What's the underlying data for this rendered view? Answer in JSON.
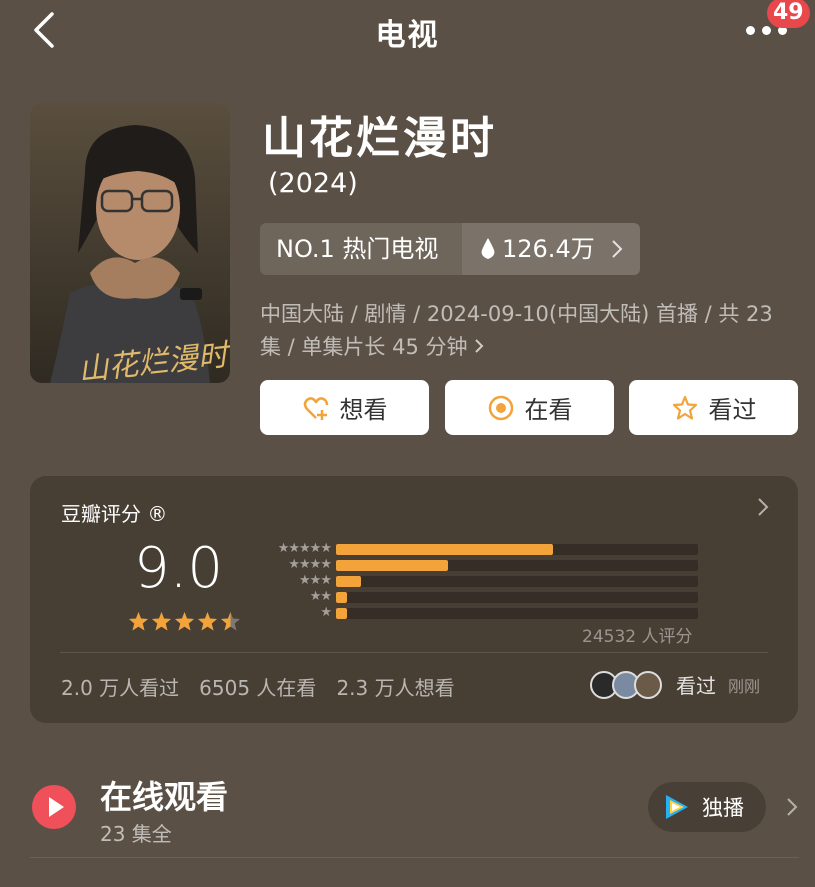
{
  "nav": {
    "title": "电视",
    "badge": "49"
  },
  "poster": {
    "text": "山花烂漫时"
  },
  "title": "山花烂漫时",
  "year": "(2024)",
  "rank": {
    "label": "NO.1 热门电视",
    "heat": "126.4万"
  },
  "meta": "中国大陆 / 剧情 / 2024-09-10(中国大陆) 首播 / 共 23 集 / 单集片长 45 分钟",
  "actions": {
    "want": "想看",
    "watching": "在看",
    "watched": "看过"
  },
  "rating": {
    "title": "豆瓣评分 ®",
    "score": "9.0",
    "stars": 4.5,
    "distribution_stars": [
      "★★★★★",
      "★★★★",
      "★★★",
      "★★",
      "★"
    ],
    "distribution": [
      0.6,
      0.31,
      0.07,
      0.03,
      0.03
    ],
    "count": "24532 人评分",
    "stats": {
      "watched": "2.0 万人看过",
      "watching": "6505 人在看",
      "want": "2.3 万人想看"
    },
    "friends_label": "看过",
    "friends_time": "刚刚"
  },
  "watch": {
    "title": "在线观看",
    "episodes": "23 集全",
    "platform": "独播"
  },
  "colors": {
    "accent": "#f2a33a",
    "background": "#5b5045",
    "card": "#473e34",
    "badge": "#e8474b"
  }
}
